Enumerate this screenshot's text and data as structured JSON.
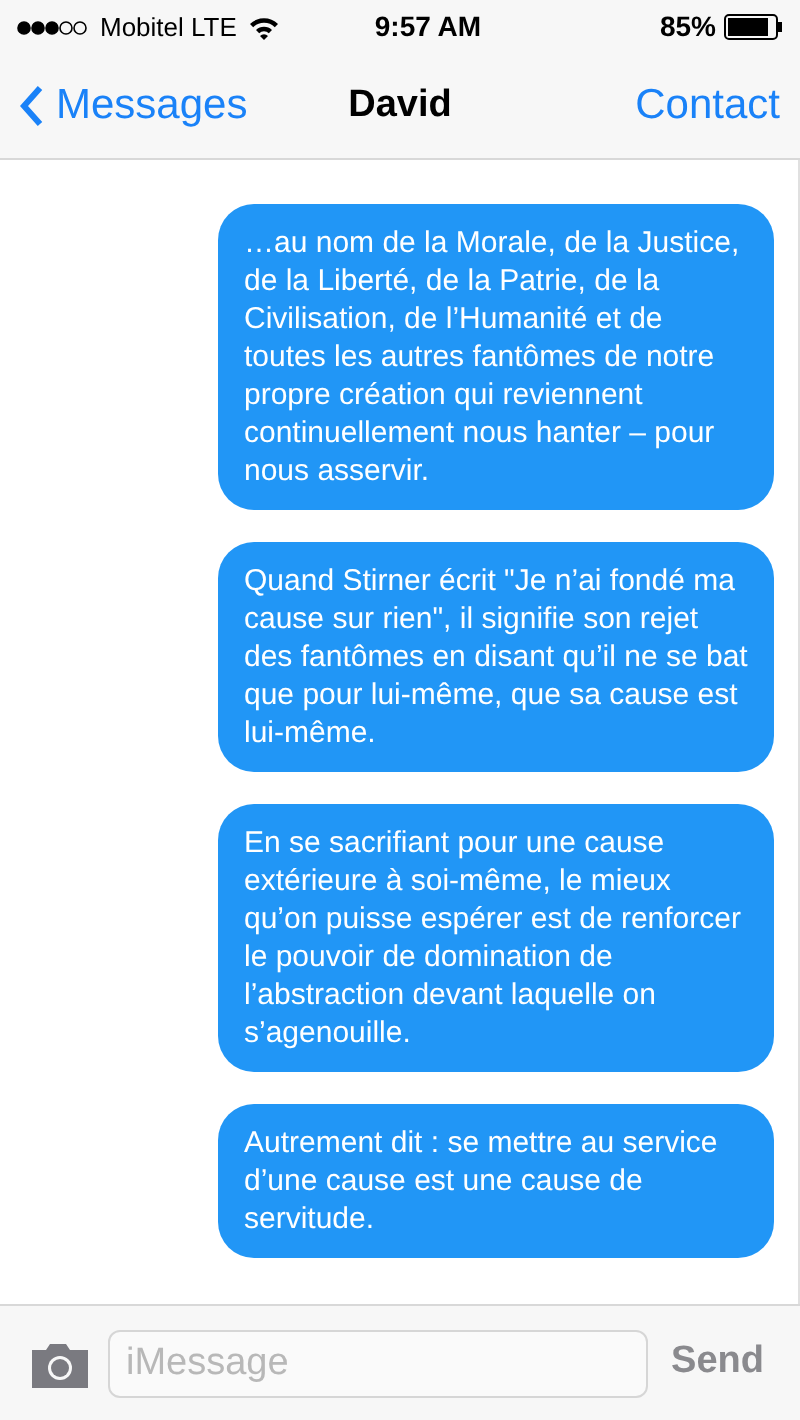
{
  "status_bar": {
    "carrier": "Mobitel LTE",
    "time": "9:57 AM",
    "battery": "85%"
  },
  "nav_bar": {
    "back": "Messages",
    "title": "David",
    "action": "Contact"
  },
  "messages": [
    {
      "text": "…au nom de la Morale, de la Justice, de la Liberté, de la Patrie, de la Civilisation, de l’Humanité et de toutes les autres fantômes de notre propre création qui reviennent continuellement nous hanter – pour nous asservir."
    },
    {
      "text": "Quand Stirner écrit \"Je n’ai fondé ma cause sur rien\", il signifie son rejet des fantômes en disant qu’il ne se bat que pour lui-même, que sa cause est lui-même."
    },
    {
      "text": "En se sacrifiant pour une cause extérieure à soi-même, le mieux qu’on puisse espérer est de renforcer le pouvoir de domination de l’abstraction devant laquelle on s’agenouille."
    },
    {
      "text": "Autrement dit : se mettre au service d’une cause est une cause de servitude."
    }
  ],
  "composer": {
    "placeholder": "iMessage",
    "send": "Send",
    "send_disabled": true
  }
}
